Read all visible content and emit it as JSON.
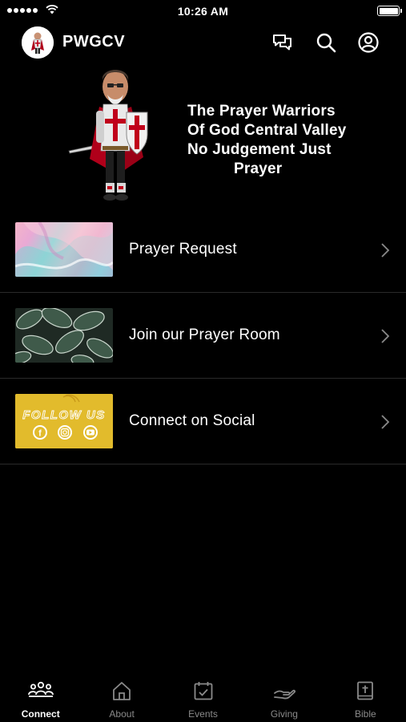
{
  "status_bar": {
    "time": "10:26 AM",
    "signal_icon": "cellular-signal-icon",
    "wifi_icon": "wifi-icon",
    "battery_icon": "battery-icon",
    "battery_level": 1.0
  },
  "header": {
    "title": "PWGCV",
    "avatar_icon": "knight-avatar",
    "actions": [
      {
        "icon": "chat-bubbles-icon"
      },
      {
        "icon": "search-icon"
      },
      {
        "icon": "profile-icon"
      }
    ]
  },
  "banner": {
    "lines": [
      "The Prayer Warriors",
      "Of God Central Valley",
      "No Judgement Just",
      "Prayer"
    ]
  },
  "list": {
    "items": [
      {
        "label": "Prayer Request",
        "thumb": "pastel-marble-image"
      },
      {
        "label": "Join our Prayer Room",
        "thumb": "green-leaves-image"
      },
      {
        "label": "Connect on Social",
        "thumb": "follow-us-image",
        "thumb_text": "FOLLOW US"
      }
    ]
  },
  "tabbar": {
    "tabs": [
      {
        "label": "Connect",
        "icon": "people-icon",
        "active": true
      },
      {
        "label": "About",
        "icon": "home-icon",
        "active": false
      },
      {
        "label": "Events",
        "icon": "calendar-icon",
        "active": false
      },
      {
        "label": "Giving",
        "icon": "giving-hand-icon",
        "active": false
      },
      {
        "label": "Bible",
        "icon": "bible-icon",
        "active": false
      }
    ]
  },
  "colors": {
    "background": "#000000",
    "text": "#ffffff",
    "inactive_tab": "#8a8a8a",
    "divider": "#2a2a2a",
    "social_yellow": "#e2bb2c"
  }
}
